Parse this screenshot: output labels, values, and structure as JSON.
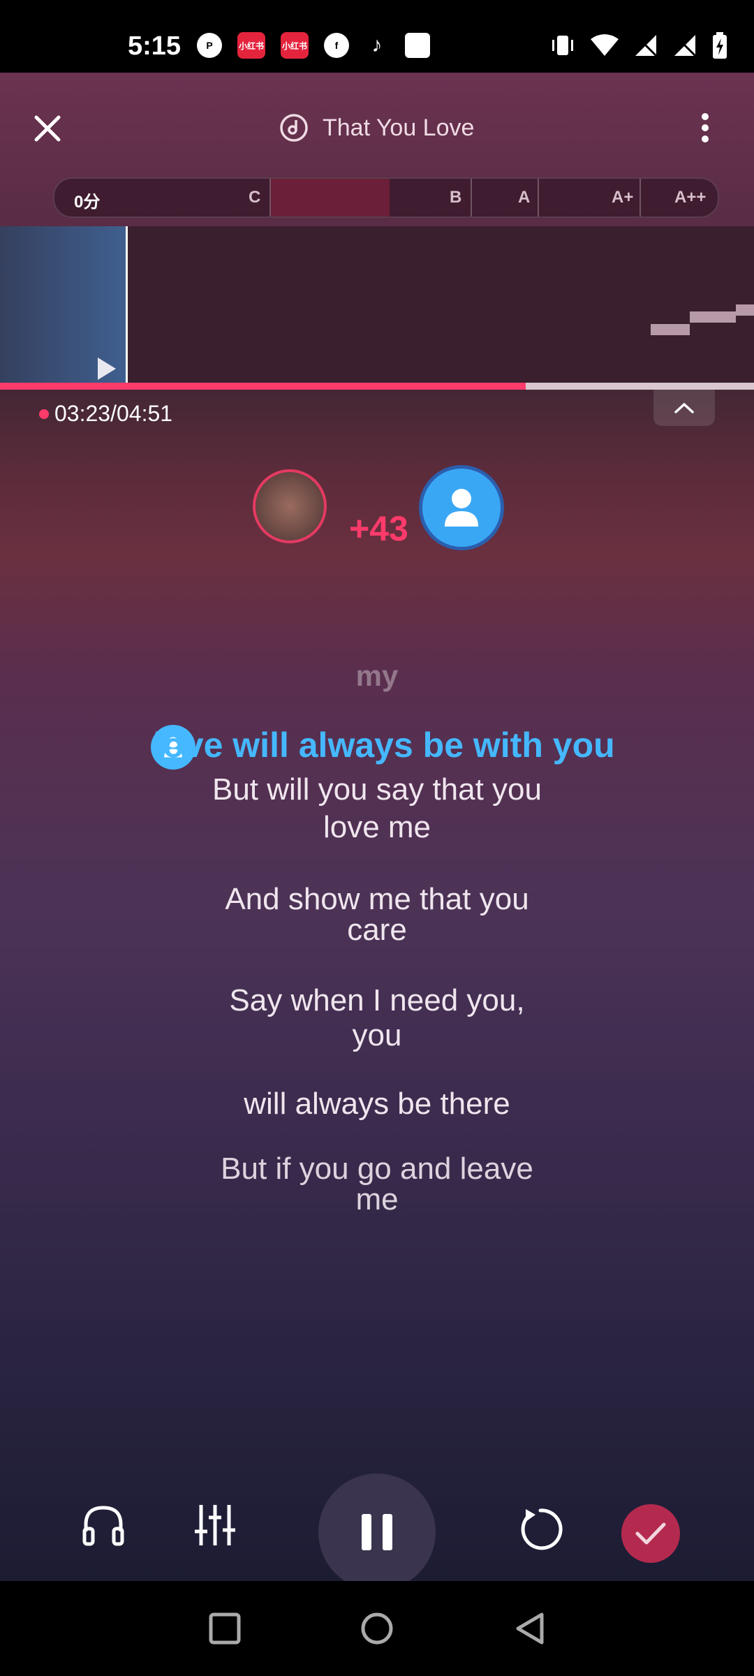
{
  "status_bar": {
    "time": "5:15",
    "left_icons": [
      "notification-p-icon",
      "xiaohongshu-icon",
      "xiaohongshu-icon",
      "facebook-icon",
      "tiktok-icon",
      "wallet-icon"
    ],
    "right_icons": [
      "vibrate-icon",
      "wifi-icon",
      "signal-icon",
      "signal-icon",
      "battery-charging-icon"
    ]
  },
  "header": {
    "title": "That You Love",
    "close_icon": "close-icon",
    "more_icon": "more-vertical-icon"
  },
  "score_bar": {
    "current": "0分",
    "grades": [
      "C",
      "B",
      "A",
      "A+",
      "A++"
    ]
  },
  "playback": {
    "current_time": "03:23",
    "total_time": "04:51",
    "time_display": "03:23/04:51",
    "progress_fraction": 0.697
  },
  "duet": {
    "score_delta": "+43"
  },
  "lyrics": {
    "previous": "my",
    "current": "love will always be with you",
    "upcoming": [
      "But will you say that you love me",
      "And show me that you care",
      "Say when I need you, you",
      "will always be there",
      "But if you go and leave me"
    ]
  },
  "controls": {
    "headphones_icon": "headphones-icon",
    "mixer_icon": "equalizer-icon",
    "pause_icon": "pause-icon",
    "restart_icon": "restart-icon",
    "finish_icon": "check-icon"
  },
  "colors": {
    "accent": "#ff3b6b",
    "lyric_highlight": "#45b8ff",
    "finish_button": "#b42a4e"
  }
}
